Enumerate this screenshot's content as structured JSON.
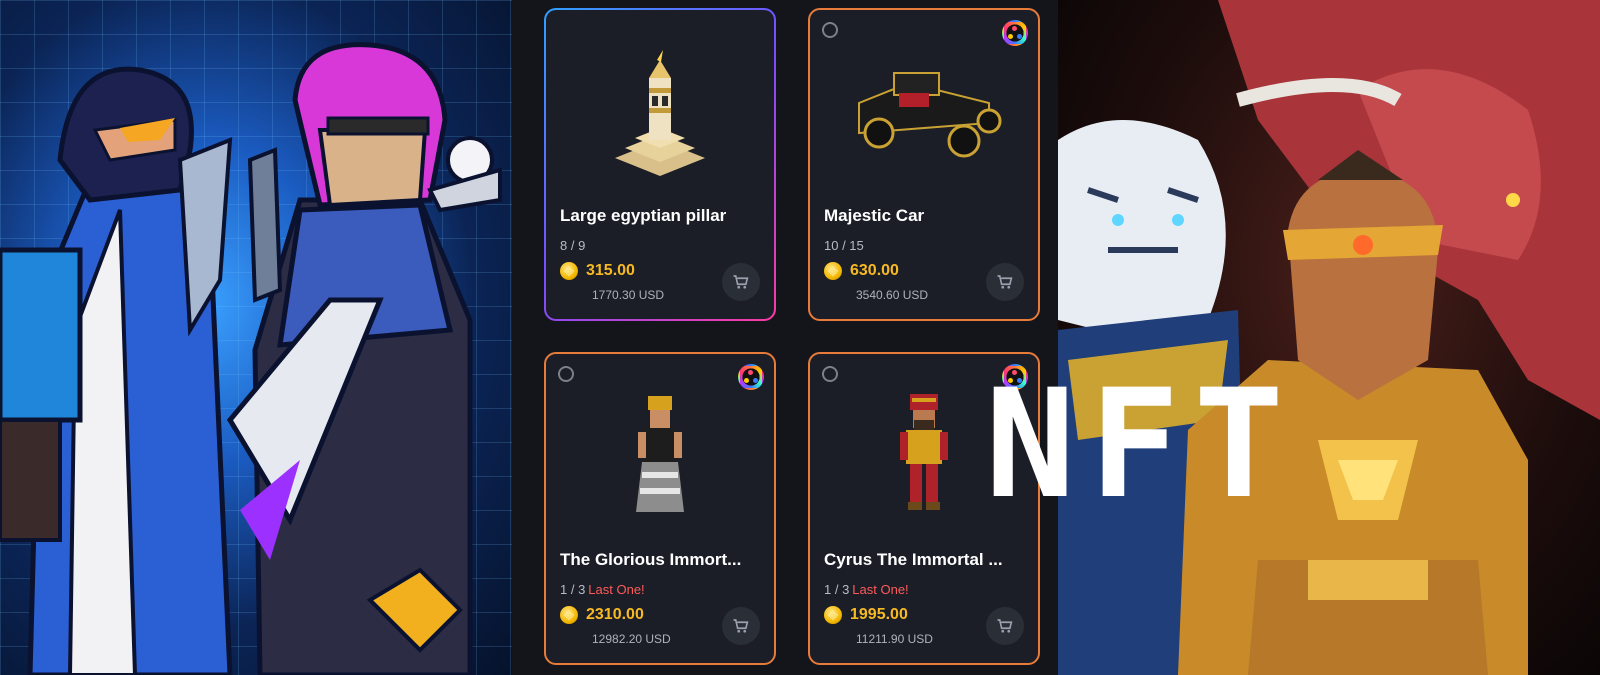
{
  "market": {
    "items": [
      {
        "title": "Large egyptian pillar",
        "stock": "8 / 9",
        "last": "",
        "price": "315.00",
        "usd": "1770.30 USD"
      },
      {
        "title": "Majestic Car",
        "stock": "10 / 15",
        "last": "",
        "price": "630.00",
        "usd": "3540.60 USD"
      },
      {
        "title": "The Glorious Immort...",
        "stock": "1 / 3",
        "last": "Last One!",
        "price": "2310.00",
        "usd": "12982.20 USD"
      },
      {
        "title": "Cyrus The Immortal ...",
        "stock": "1 / 3",
        "last": "Last One!",
        "price": "1995.00",
        "usd": "11211.90 USD"
      }
    ]
  },
  "overlay": {
    "text": "NFT"
  }
}
